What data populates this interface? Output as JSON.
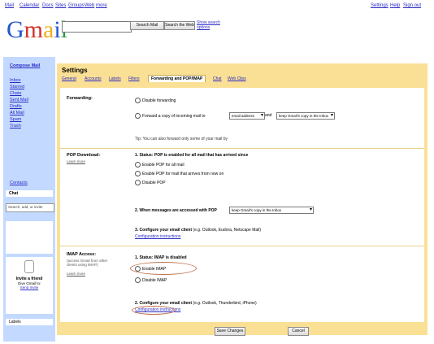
{
  "topnav": {
    "links": [
      "Mail",
      "Calendar",
      "Docs",
      "Sites",
      "Groups",
      "Web",
      "more"
    ],
    "user": "",
    "right_links": [
      "Settings",
      "Help",
      "Sign out"
    ]
  },
  "header": {
    "logo": "Gmail",
    "search_mail": "Search Mail",
    "search_web": "Search the Web",
    "search_options": "Show search options"
  },
  "sidebar": {
    "compose": "Compose Mail",
    "items": [
      "Inbox",
      "Starred",
      "Chats",
      "Sent Mail",
      "Drafts",
      "All Mail",
      "Spam",
      "Trash"
    ],
    "contacts": "Contacts",
    "chat": "Chat",
    "search_people": "Search, add, or invite",
    "status": "",
    "labels": "Labels"
  },
  "settings": {
    "title": "Settings",
    "tabs": [
      "General",
      "Accounts",
      "Labels",
      "Filters",
      "Forwarding and POP/IMAP",
      "Chat",
      "Web Clips"
    ],
    "forwarding": {
      "label": "Forwarding:",
      "option_disable": "Disable forwarding",
      "option_forward": "Forward a copy of incoming mail to",
      "email_placeholder": "email address",
      "and": "and",
      "keep_option": "keep Gmail's copy in the Inbox",
      "tip": "Tip: You can also forward only some of your mail by"
    },
    "pop": {
      "label": "POP Download:",
      "learn_more": "Learn more",
      "status": "1. Status: POP is enabled for all mail that has arrived since",
      "enable_all": "Enable POP for all mail",
      "enable_now": "Enable POP for mail that arrives from now on",
      "disable": "Disable POP",
      "when_accessed": "2. When messages are accessed with POP",
      "keep_select": "keep Gmail's copy in the Inbox",
      "configure": "3. Configure your email client",
      "configure_detail": "(e.g. Outlook, Eudora, Netscape Mail)",
      "config_link": "Configuration instructions"
    },
    "imap": {
      "label": "IMAP Access:",
      "sub": "(access Gmail from other clients using IMAP)",
      "learn_more": "Learn more",
      "status": "1. Status: IMAP is disabled",
      "enable": "Enable IMAP",
      "disable": "Disable IMAP",
      "configure": "2. Configure your email client",
      "configure_detail": "(e.g. Outlook, Thunderbird, iPhone)",
      "config_link": "Configuration instructions"
    },
    "cancel": "Cancel",
    "save": "Save Changes"
  },
  "invite": {
    "title": "Invite a friend",
    "text": "Give Gmail to:",
    "link": "Send Invite"
  },
  "colors": {
    "panel": "#fae095",
    "sidebar": "#c3d9ff",
    "link": "#2a2ac4"
  }
}
